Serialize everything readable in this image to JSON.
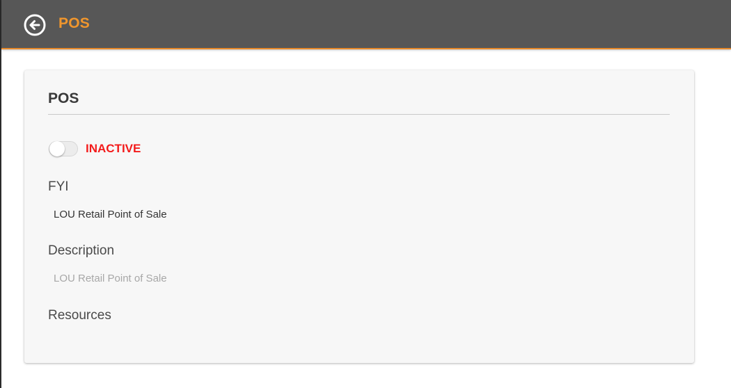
{
  "header": {
    "title": "POS",
    "back_icon": "arrow-left-circle-icon",
    "background_color": "#575757",
    "accent_color": "#f0962d"
  },
  "card": {
    "title": "POS",
    "status": {
      "label": "INACTIVE",
      "active": false,
      "color": "#f31b1b"
    },
    "fields": {
      "fyi": {
        "label": "FYI",
        "value": "LOU Retail Point of Sale"
      },
      "description": {
        "label": "Description",
        "placeholder": "LOU Retail Point of Sale"
      },
      "resources": {
        "label": "Resources"
      }
    }
  }
}
